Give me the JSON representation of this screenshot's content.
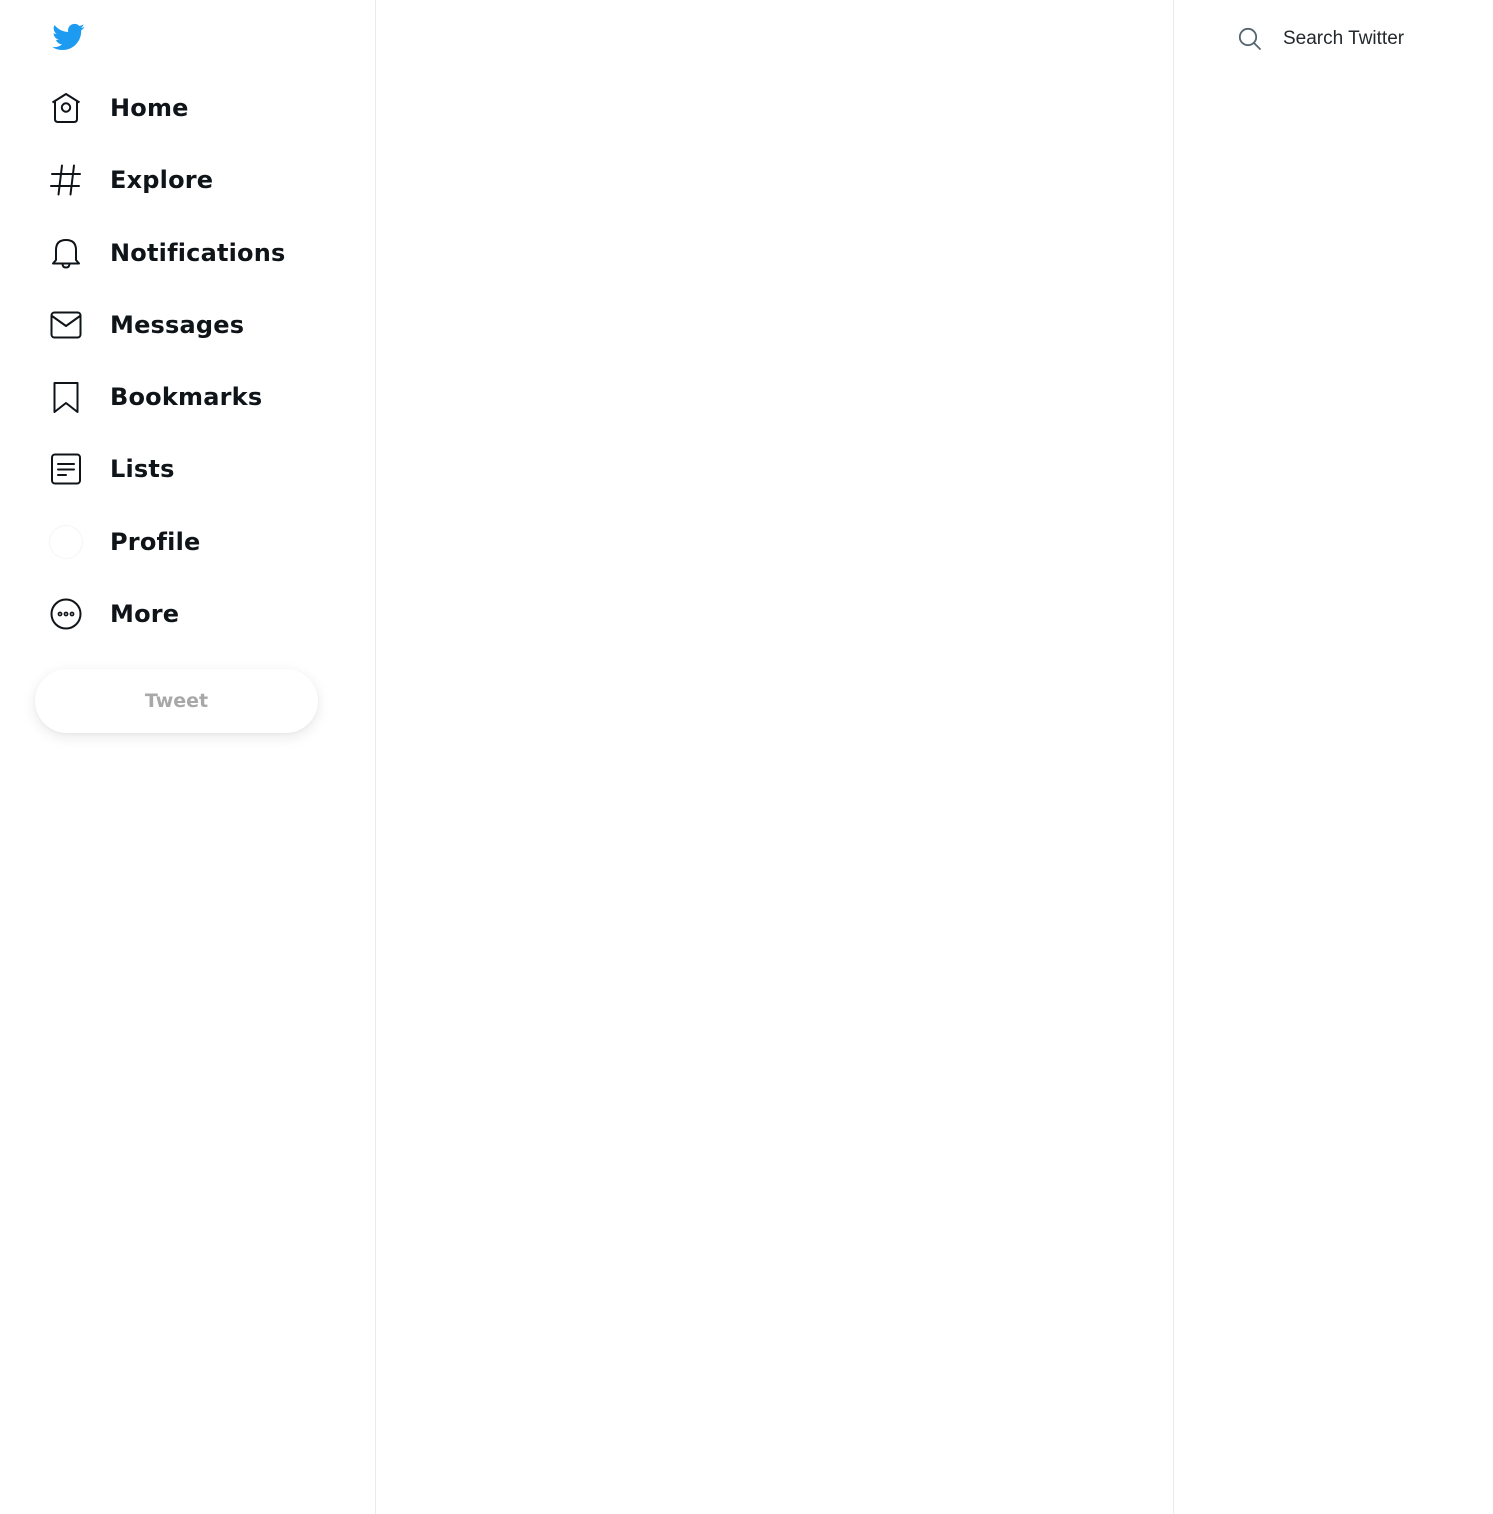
{
  "app": {
    "title": "Twitter",
    "accent_color": "#1d9bf0"
  },
  "sidebar": {
    "logo_icon": "twitter-bird-icon",
    "items": [
      {
        "label": "Home",
        "icon": "home-icon"
      },
      {
        "label": "Explore",
        "icon": "hashtag-icon"
      },
      {
        "label": "Notifications",
        "icon": "bell-icon"
      },
      {
        "label": "Messages",
        "icon": "envelope-icon"
      },
      {
        "label": "Bookmarks",
        "icon": "bookmark-icon"
      },
      {
        "label": "Lists",
        "icon": "list-icon"
      },
      {
        "label": "Profile",
        "icon": "avatar"
      },
      {
        "label": "More",
        "icon": "more-circle-icon"
      }
    ],
    "tweet_button_label": "Tweet"
  },
  "search": {
    "placeholder": "Search Twitter",
    "icon": "search-icon"
  }
}
